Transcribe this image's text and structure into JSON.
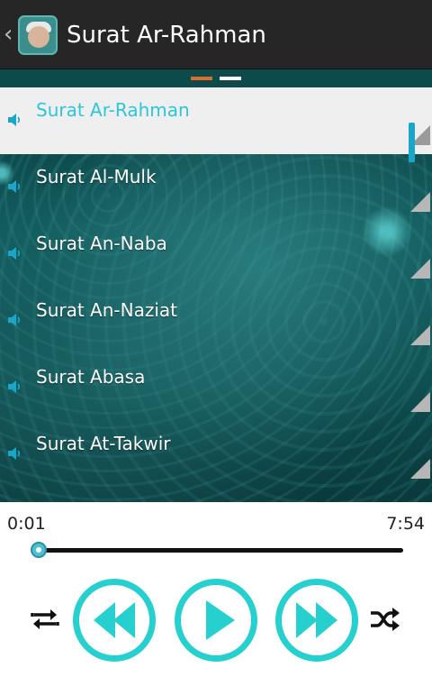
{
  "header": {
    "title": "Surat Ar-Rahman",
    "back_icon": "chevron-left-icon",
    "app_icon": "reciter-avatar-icon"
  },
  "page_indicator": {
    "pages": 2,
    "active_color": "#e06a2b",
    "inactive_color": "#ffffff"
  },
  "playlist": {
    "items": [
      {
        "label": "Surat Ar-Rahman",
        "selected": true
      },
      {
        "label": "Surat Al-Mulk",
        "selected": false
      },
      {
        "label": "Surat An-Naba",
        "selected": false
      },
      {
        "label": "Surat An-Naziat",
        "selected": false
      },
      {
        "label": "Surat Abasa",
        "selected": false
      },
      {
        "label": "Surat At-Takwir",
        "selected": false
      }
    ],
    "item_icon": "speaker-icon",
    "selected_color": "#2cc6d9"
  },
  "player": {
    "current_time": "0:01",
    "total_time": "7:54",
    "progress_fraction": 0.002,
    "accent_color": "#26d0cf",
    "controls": {
      "repeat_icon": "repeat-icon",
      "rewind_icon": "rewind-icon",
      "play_icon": "play-icon",
      "forward_icon": "fast-forward-icon",
      "shuffle_icon": "shuffle-icon"
    }
  }
}
